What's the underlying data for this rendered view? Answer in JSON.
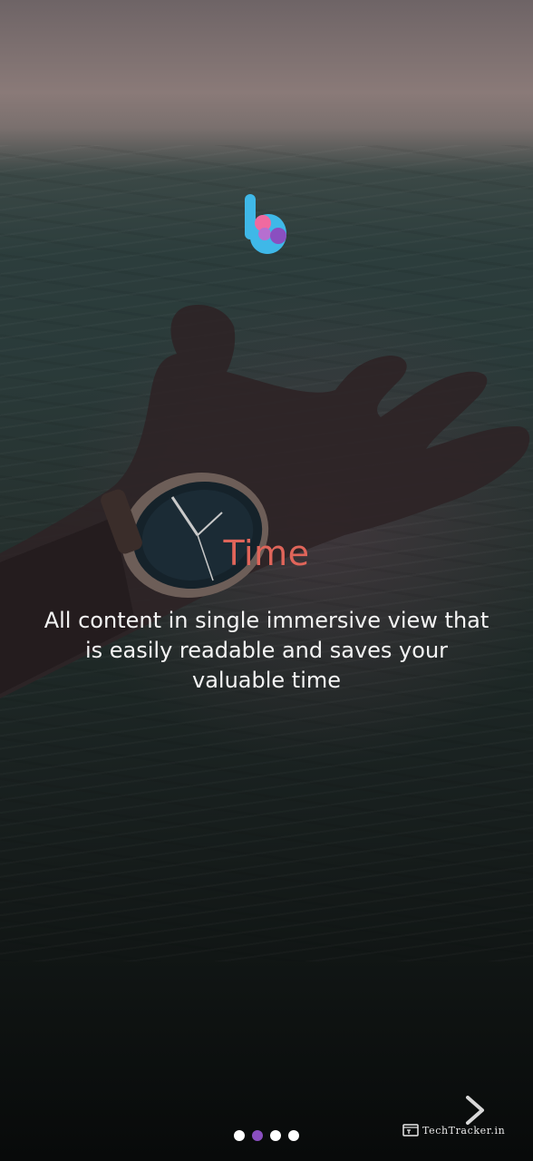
{
  "onboarding": {
    "title": "Time",
    "description": "All content in single immersive view that is easily readable and saves your valuable time",
    "colors": {
      "title": "#e0655a",
      "description": "#f4f4f4",
      "active_dot": "#8a4fc0",
      "inactive_dot": "#ffffff"
    },
    "page_indicator": {
      "total": 4,
      "active_index": 1
    }
  },
  "logo": {
    "icon": "b-logo-icon",
    "colors": [
      "#3fb8e8",
      "#f06aa0",
      "#8a4fc0"
    ]
  },
  "navigation": {
    "next_icon": "chevron-right-icon"
  },
  "watermark": {
    "text": "TechTracker.in"
  }
}
